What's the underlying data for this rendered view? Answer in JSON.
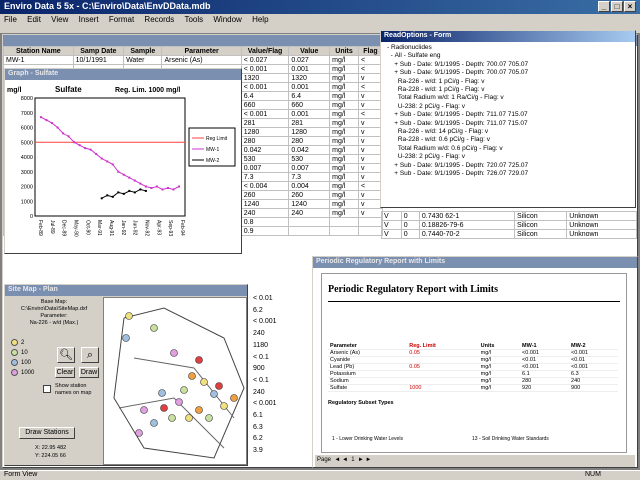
{
  "app": {
    "title": "Enviro Data 5 5x - C:\\Enviro\\Data\\EnvDData.mdb"
  },
  "menu": [
    "File",
    "Edit",
    "View",
    "Insert",
    "Format",
    "Records",
    "Tools",
    "Window",
    "Help"
  ],
  "grid": {
    "columns": [
      "Station Name",
      "Samp Date",
      "Sample",
      "Parameter",
      "Value/Flag",
      "Value",
      "Units",
      "Flag"
    ],
    "rows": [
      [
        "MW-1",
        "10/1/1991",
        "Water",
        "Arsenic (As)",
        "< 0.027",
        "0.027",
        "mg/l",
        "<"
      ],
      [
        "",
        "",
        "",
        "",
        "< 0.001",
        "0.001",
        "mg/l",
        "<"
      ],
      [
        "",
        "",
        "",
        "",
        "1320",
        "1320",
        "mg/l",
        "v"
      ],
      [
        "",
        "",
        "",
        "",
        "< 0.001",
        "0.001",
        "mg/l",
        "<"
      ],
      [
        "",
        "",
        "",
        "",
        "6.4",
        "6.4",
        "mg/l",
        "v"
      ],
      [
        "",
        "",
        "",
        "",
        "660",
        "660",
        "mg/l",
        "v"
      ],
      [
        "",
        "",
        "",
        "",
        "< 0.001",
        "0.001",
        "mg/l",
        "<"
      ],
      [
        "",
        "",
        "",
        "",
        "281",
        "281",
        "mg/l",
        "v"
      ],
      [
        "",
        "",
        "",
        "",
        "1280",
        "1280",
        "mg/l",
        "v"
      ],
      [
        "",
        "",
        "",
        "",
        "280",
        "280",
        "mg/l",
        "v"
      ],
      [
        "",
        "",
        "",
        "",
        "0.042",
        "0.042",
        "mg/l",
        "v"
      ],
      [
        "",
        "",
        "",
        "",
        "530",
        "530",
        "mg/l",
        "v"
      ],
      [
        "",
        "",
        "",
        "",
        "0.007",
        "0.007",
        "mg/l",
        "v"
      ],
      [
        "",
        "",
        "",
        "",
        "7.3",
        "7.3",
        "mg/l",
        "v"
      ],
      [
        "",
        "",
        "",
        "",
        "< 0.004",
        "0.004",
        "mg/l",
        "<"
      ],
      [
        "",
        "",
        "",
        "",
        "260",
        "260",
        "mg/l",
        "v"
      ],
      [
        "",
        "",
        "",
        "",
        "1240",
        "1240",
        "mg/l",
        "v"
      ],
      [
        "",
        "",
        "",
        "",
        "240",
        "240",
        "mg/l",
        "v"
      ],
      [
        "MW-1",
        "7/20/1992",
        "Water",
        "Potassium",
        "0.8",
        "",
        "",
        ""
      ],
      [
        "MW-1",
        "7/20/1992",
        "Water",
        "Sodium",
        "0.9",
        "",
        "",
        ""
      ]
    ],
    "extra_values": [
      "< 0.01",
      "6.2",
      "< 0.001",
      "240",
      "1180",
      "< 0.1",
      "900",
      "< 0.1",
      "240",
      "< 0.001",
      "6.1",
      "6.3",
      "6.2",
      "3.9"
    ]
  },
  "lower_rows": [
    [
      "V",
      "0",
      "0.7430 62-1",
      "Silicon",
      "Unknown"
    ],
    [
      "V",
      "0",
      "0.18826-79-6",
      "Silicon",
      "Unknown"
    ],
    [
      "V",
      "0",
      "0.7440-70-2",
      "Silicon",
      "Unknown"
    ]
  ],
  "chart_window": {
    "title": "Graph - Sulfate"
  },
  "chart_data": {
    "type": "line",
    "title": "Sulfate",
    "subtitle": "Reg. Lim. 1000 mg/l",
    "ylabel": "mg/l",
    "ylim": [
      0,
      8000
    ],
    "yticks": [
      "8000",
      "7000",
      "6000",
      "5000",
      "4000",
      "3000",
      "2000",
      "1000",
      "0"
    ],
    "xticks": [
      "Feb-89",
      "Jul-89",
      "Dec-89",
      "May-90",
      "Oct-90",
      "Mar-91",
      "Aug-91",
      "Jan-92",
      "Jun-92",
      "Nov-92",
      "Apr-93",
      "Sep-93",
      "Feb-94"
    ],
    "reference": {
      "name": "Reg Limit",
      "value": 5000,
      "color": "#ff4040"
    },
    "series": [
      {
        "name": "MW-1",
        "color": "#cc33cc",
        "values": [
          6700,
          6500,
          6300,
          6000,
          5600,
          5400,
          5000,
          4800,
          4600,
          4500,
          4200,
          3900,
          3700,
          3500,
          3000,
          2800,
          2600,
          2400,
          2200,
          2000,
          1900,
          2000,
          1800,
          1900,
          1800,
          2000
        ]
      },
      {
        "name": "MW-2",
        "color": "#000000",
        "values": [
          null,
          null,
          null,
          null,
          null,
          null,
          null,
          null,
          null,
          null,
          null,
          1200,
          1400,
          1300,
          1600,
          1500,
          1700,
          1600,
          1800,
          1700,
          null,
          null,
          null,
          null,
          null,
          null
        ]
      }
    ],
    "legend_position": "right"
  },
  "tree": {
    "title": "ReadOptions - Form",
    "lines": [
      "- Radionuclides",
      "  - All - Sulfate eng",
      "    + Sub - Date: 9/1/1995 - Depth: 700.07 705.07",
      "    + Sub - Date: 9/1/1995 - Depth: 700.07 705.07",
      "      Ra-226 - w/d: 1 pCi/g - Flag: v",
      "      Ra-228 - w/d: 1 pCi/g - Flag: v",
      "      Total Radium w/d: 1 Ra/Ci/g - Flag: v",
      "      U-238: 2 pCi/g - Flag: v",
      "    + Sub - Date: 9/1/1995 - Depth: 711.07 715.07",
      "    + Sub - Date: 9/1/1995 - Depth: 711.07 715.07",
      "      Ra-226 - w/d: 14 pCi/g - Flag: v",
      "      Ra-228 - w/d: 0.6 pCi/g - Flag: v",
      "      Total Radium w/d: 0.6 pCi/g - Flag: v",
      "      U-238: 2 pCi/g - Flag: v",
      "    + Sub - Date: 9/1/1995 - Depth: 720.07 725.07",
      "    + Sub - Date: 9/1/1995 - Depth: 726.07 729.07"
    ]
  },
  "map": {
    "title": "Site Map - Plan",
    "info": [
      "Base Map:",
      "C:\\Enviro\\Data\\SiteMap.dxf",
      "Parameter:",
      "Na-226 - w/d (Max.)"
    ],
    "buttons": {
      "clear": "Clear",
      "draw": "Draw",
      "draw_stations": "Draw Stations"
    },
    "legend_values": [
      "2",
      "10",
      "100",
      "1000"
    ],
    "checkbox_label": "Show station names on map",
    "coords": [
      "X: 22.95 482",
      "Y: 224.05 66"
    ]
  },
  "report": {
    "title": "Periodic Regulatory Report with Limits",
    "header_cols": [
      "Parameter",
      "Reg. Limit",
      "Units",
      "MW-1",
      "MW-2"
    ],
    "rows": [
      [
        "Arsenic (As)",
        "0.05",
        "mg/l",
        "<0.001",
        "<0.001"
      ],
      [
        "Cyanide",
        "",
        "mg/l",
        "<0.01",
        "<0.01"
      ],
      [
        "Lead (Pb)",
        "0.05",
        "mg/l",
        "<0.001",
        "<0.001"
      ],
      [
        "Potassium",
        "",
        "mg/l",
        "6.1",
        "6.3"
      ],
      [
        "Sodium",
        "",
        "mg/l",
        "280",
        "240"
      ],
      [
        "Sulfate",
        "1000",
        "mg/l",
        "920",
        "900"
      ]
    ],
    "footer_title": "Regulatory Subset Types",
    "footer_left": "1 - Lower Drinking Water Levels",
    "footer_right": "13 - Soil Drinking Water Standards",
    "page_label": "Page"
  },
  "status": {
    "left": "Form View",
    "right": "NUM"
  }
}
